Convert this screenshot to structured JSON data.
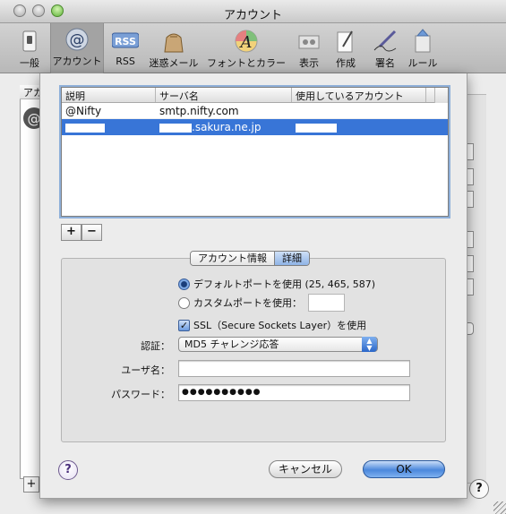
{
  "window": {
    "title": "アカウント"
  },
  "toolbar": {
    "items": [
      {
        "label": "一般",
        "icon": "switch-icon"
      },
      {
        "label": "アカウント",
        "icon": "at-sign-icon"
      },
      {
        "label": "RSS",
        "icon": "rss-icon"
      },
      {
        "label": "迷惑メール",
        "icon": "junk-mail-bag-icon"
      },
      {
        "label": "フォントとカラー",
        "icon": "font-color-icon"
      },
      {
        "label": "表示",
        "icon": "viewing-icon"
      },
      {
        "label": "作成",
        "icon": "compose-icon"
      },
      {
        "label": "署名",
        "icon": "signature-icon"
      },
      {
        "label": "ルール",
        "icon": "rules-icon"
      }
    ]
  },
  "background": {
    "accounts_header": "アカウント",
    "add_label": "+",
    "help_label": "?"
  },
  "sheet": {
    "table": {
      "headers": [
        "説明",
        "サーバ名",
        "使用しているアカウント"
      ],
      "rows": [
        {
          "description": "@Nifty",
          "server": "smtp.nifty.com",
          "account": "",
          "selected": false
        },
        {
          "description": "",
          "server": ".sakura.ne.jp",
          "account": "",
          "selected": true
        }
      ]
    },
    "add_label": "+",
    "remove_label": "−",
    "tabs": [
      {
        "label": "アカウント情報",
        "active": false
      },
      {
        "label": "詳細",
        "active": true
      }
    ],
    "port_default_label": "デフォルトポートを使用 (25, 465, 587)",
    "port_custom_label": "カスタムポートを使用：",
    "port_custom_value": "",
    "ssl_label": "SSL（Secure Sockets Layer）を使用",
    "ssl_checked": true,
    "auth_label": "認証：",
    "auth_value": "MD5 チャレンジ応答",
    "username_label": "ユーザ名：",
    "username_value": "",
    "password_label": "パスワード：",
    "password_value": "●●●●●●●●●●",
    "help_label": "?",
    "cancel_label": "キャンセル",
    "ok_label": "OK"
  }
}
